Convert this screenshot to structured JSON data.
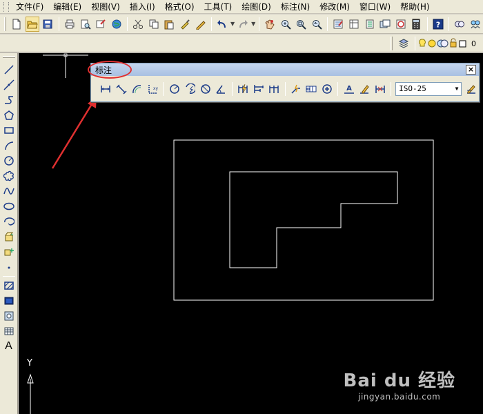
{
  "menu": {
    "items": [
      "文件(F)",
      "编辑(E)",
      "视图(V)",
      "插入(I)",
      "格式(O)",
      "工具(T)",
      "绘图(D)",
      "标注(N)",
      "修改(M)",
      "窗口(W)",
      "帮助(H)"
    ]
  },
  "layers": {
    "current": "0"
  },
  "dimension_toolbar": {
    "title": "标注",
    "close_label": "×",
    "dim_style": "ISO-25"
  },
  "draw_toolbar": {
    "text_tool_label": "A"
  },
  "ucs": {
    "y_label": "Y"
  },
  "watermark": {
    "brand": "Bai du 经验",
    "url": "jingyan.baidu.com"
  },
  "colors": {
    "annotation_red": "#e03030",
    "canvas": "#000000",
    "lines": "#ffffff"
  }
}
